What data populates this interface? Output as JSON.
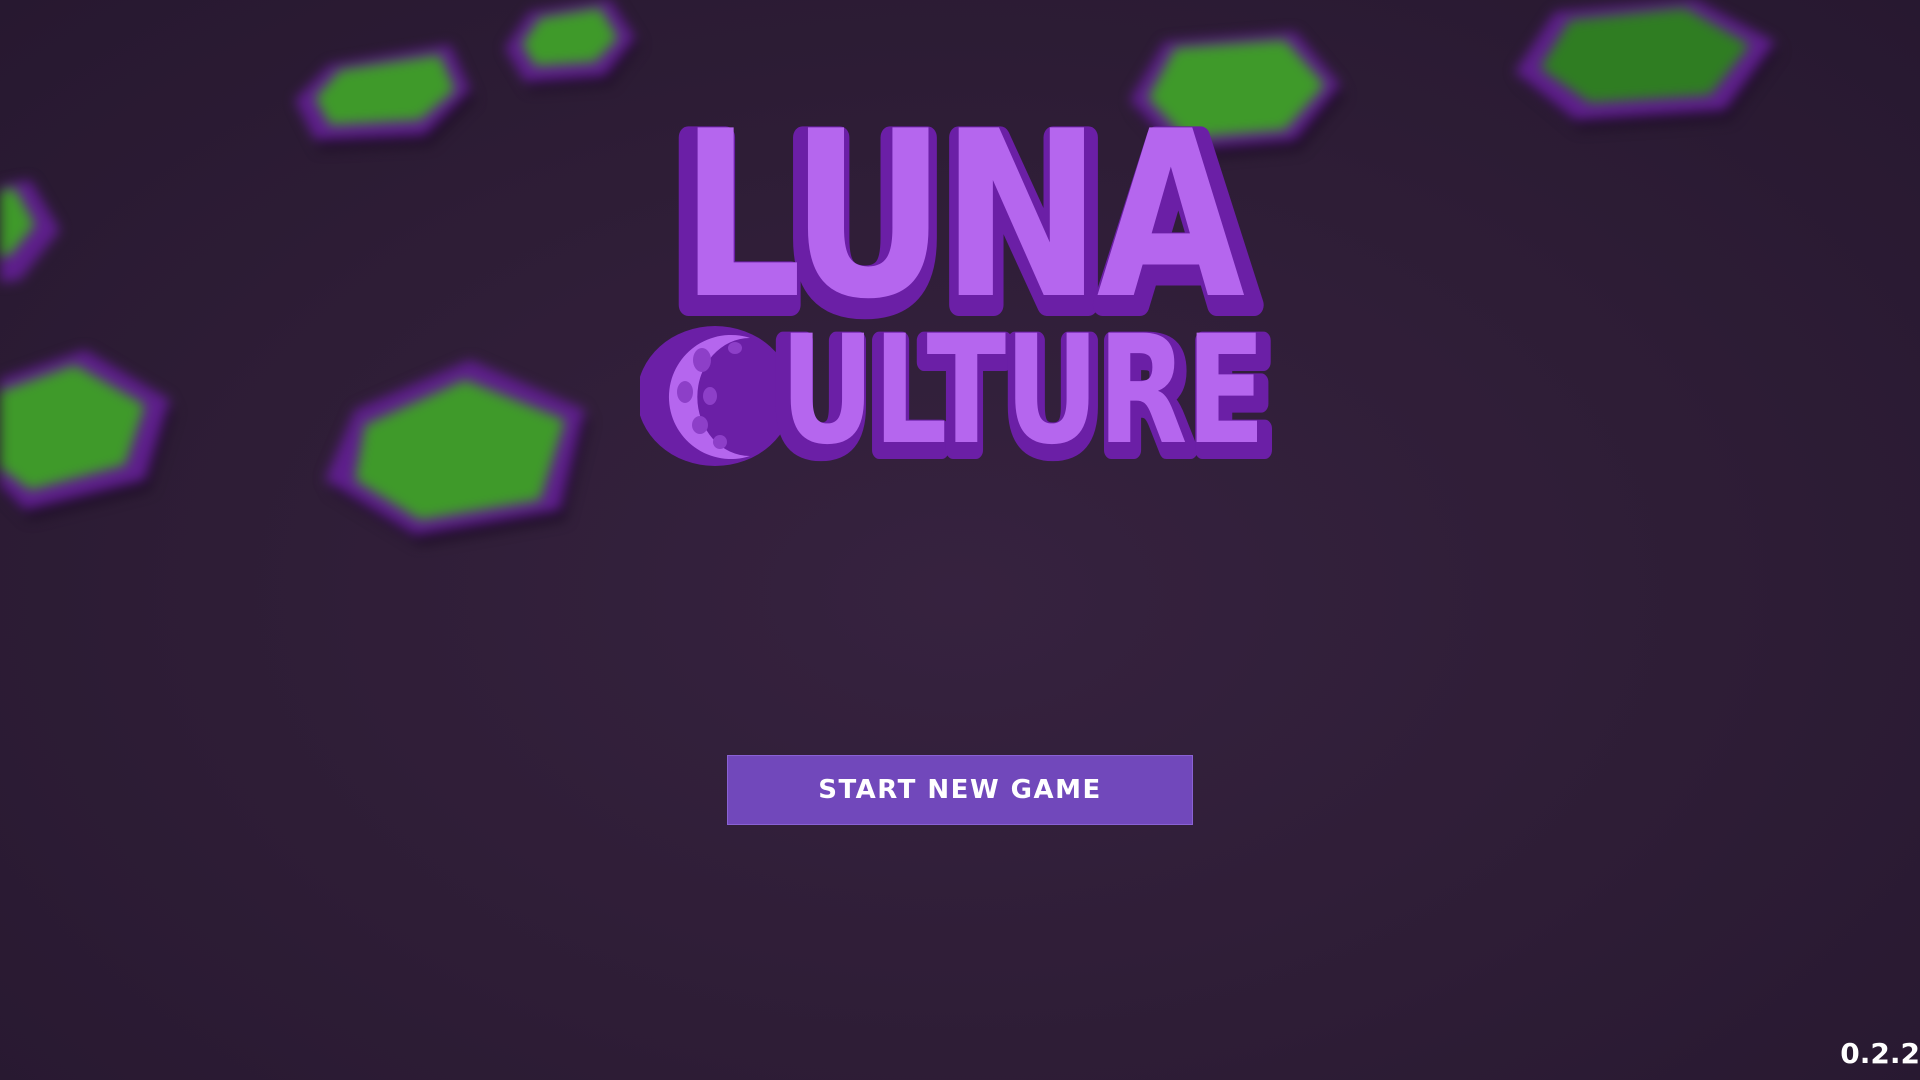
{
  "game": {
    "logo": {
      "line1": "LUNA",
      "line2": "ULTURE",
      "emblem": "crescent-moon-icon",
      "colors": {
        "face": "#b566ee",
        "outline": "#6b1fa6",
        "moon_spots": "#8d3fc8"
      }
    },
    "menu": {
      "start_label": "START NEW GAME"
    },
    "version": "0.2.2"
  },
  "colors": {
    "background": "#2d1c35",
    "button": "#7148bb",
    "tile_green": "#3f9a2a",
    "tile_purple": "#5e1e8c"
  }
}
